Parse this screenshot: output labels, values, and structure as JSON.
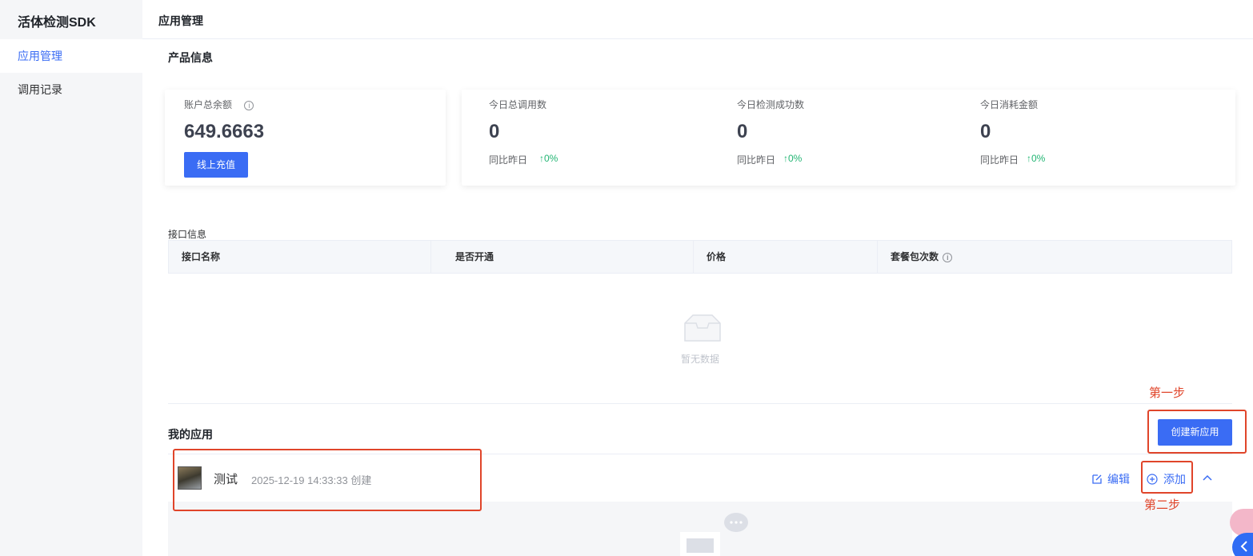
{
  "sidebar": {
    "app_title": "活体检测SDK",
    "items": [
      {
        "label": "应用管理",
        "active": true
      },
      {
        "label": "调用记录",
        "active": false
      }
    ]
  },
  "header": {
    "title": "应用管理"
  },
  "product": {
    "section_title": "产品信息",
    "balance": {
      "label": "账户总余额",
      "value": "649.6663",
      "button": "线上充值"
    },
    "stats": [
      {
        "label": "今日总调用数",
        "value": "0",
        "compare_label": "同比昨日",
        "change": "↑0%"
      },
      {
        "label": "今日检测成功数",
        "value": "0",
        "compare_label": "同比昨日",
        "change": "↑0%"
      },
      {
        "label": "今日消耗金额",
        "value": "0",
        "compare_label": "同比昨日",
        "change": "↑0%"
      }
    ]
  },
  "interface": {
    "label": "接口信息",
    "columns": [
      "接口名称",
      "是否开通",
      "价格",
      "套餐包次数"
    ],
    "empty_text": "暂无数据"
  },
  "my_apps": {
    "title": "我的应用",
    "create_button": "创建新应用",
    "apps": [
      {
        "name": "测试",
        "created": "2025-12-19 14:33:33 创建",
        "edit": "编辑",
        "add": "添加"
      }
    ]
  },
  "annotations": {
    "step1": "第一步",
    "step2": "第二步"
  },
  "colors": {
    "primary": "#3a6cf4",
    "success": "#22b573",
    "annotation": "#e0452a"
  }
}
